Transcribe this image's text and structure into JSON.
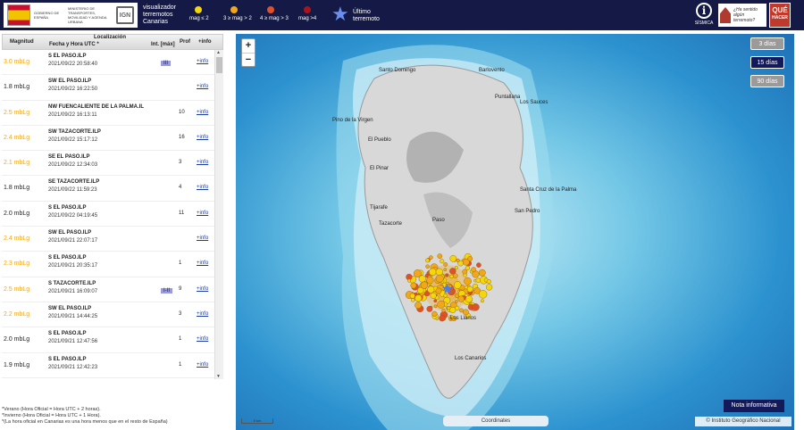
{
  "header": {
    "gov_text": "GOBIERNO DE ESPAÑA",
    "ministry_text": "MINISTERIO DE TRANSPORTES, MOVILIDAD Y AGENDA URBANA",
    "app_title_lines": [
      "visualizador",
      "terremotos",
      "Canarias"
    ],
    "legend": [
      {
        "label": "mag ≤ 2",
        "color": "#f5d60a"
      },
      {
        "label": "3 ≥ mag > 2",
        "color": "#f0a81a"
      },
      {
        "label": "4 ≥ mag > 3",
        "color": "#e0502a"
      },
      {
        "label": "mag >4",
        "color": "#a8141c"
      }
    ],
    "last_quake_label_lines": [
      "Último",
      "terremoto"
    ],
    "sismica_label": "SÍSMICA",
    "felt_lines": [
      "¿Ha sentido",
      "algún",
      "terremoto?"
    ],
    "que_hacer": [
      "QUÉ",
      "HACER"
    ]
  },
  "table": {
    "col_magnitud": "Magnitud",
    "col_localizacion": "Localización",
    "col_fecha": "Fecha y Hora UTC *",
    "col_int": "Int. [máx]",
    "col_prof": "Prof",
    "col_info": "+info",
    "rows": [
      {
        "mag": "3.0 mbLg",
        "mag_color": "#f0a81a",
        "loc": "S EL PASO.ILP",
        "dt": "2021/09/22 20:58:40",
        "int": "III",
        "prof": "",
        "info": "+info"
      },
      {
        "mag": "1.8 mbLg",
        "mag_color": "#222222",
        "loc": "SW EL PASO.ILP",
        "dt": "2021/09/22 16:22:50",
        "int": "",
        "prof": "",
        "info": "+info"
      },
      {
        "mag": "2.5 mbLg",
        "mag_color": "#f0a81a",
        "loc": "NW FUENCALIENTE DE LA PALMA.IL",
        "dt": "2021/09/22 16:13:11",
        "int": "",
        "prof": "10",
        "info": "+info"
      },
      {
        "mag": "2.4 mbLg",
        "mag_color": "#f0a81a",
        "loc": "SW TAZACORTE.ILP",
        "dt": "2021/09/22 15:17:12",
        "int": "",
        "prof": "16",
        "info": "+info"
      },
      {
        "mag": "2.1 mbLg",
        "mag_color": "#f0a81a",
        "loc": "SE EL PASO.ILP",
        "dt": "2021/09/22 12:34:03",
        "int": "",
        "prof": "3",
        "info": "+info"
      },
      {
        "mag": "1.8 mbLg",
        "mag_color": "#222222",
        "loc": "SE TAZACORTE.ILP",
        "dt": "2021/09/22 11:59:23",
        "int": "",
        "prof": "4",
        "info": "+info"
      },
      {
        "mag": "2.0 mbLg",
        "mag_color": "#222222",
        "loc": "S EL PASO.ILP",
        "dt": "2021/09/22 04:19:45",
        "int": "",
        "prof": "11",
        "info": "+info"
      },
      {
        "mag": "2.4 mbLg",
        "mag_color": "#f0a81a",
        "loc": "SW EL PASO.ILP",
        "dt": "2021/09/21 22:07:17",
        "int": "",
        "prof": "",
        "info": "+info"
      },
      {
        "mag": "2.3 mbLg",
        "mag_color": "#f0a81a",
        "loc": "S EL PASO.ILP",
        "dt": "2021/09/21 20:35:17",
        "int": "",
        "prof": "1",
        "info": "+info"
      },
      {
        "mag": "2.5 mbLg",
        "mag_color": "#f0a81a",
        "loc": "S TAZACORTE.ILP",
        "dt": "2021/09/21 16:09:07",
        "int": "I-II",
        "prof": "9",
        "info": "+info"
      },
      {
        "mag": "2.2 mbLg",
        "mag_color": "#f0a81a",
        "loc": "SW EL PASO.ILP",
        "dt": "2021/09/21 14:44:25",
        "int": "",
        "prof": "3",
        "info": "+info"
      },
      {
        "mag": "2.0 mbLg",
        "mag_color": "#222222",
        "loc": "S EL PASO.ILP",
        "dt": "2021/09/21 12:47:56",
        "int": "",
        "prof": "1",
        "info": "+info"
      },
      {
        "mag": "1.9 mbLg",
        "mag_color": "#222222",
        "loc": "S EL PASO.ILP",
        "dt": "2021/09/21 12:42:23",
        "int": "",
        "prof": "1",
        "info": "+info"
      },
      {
        "mag": "2.1 mbLg",
        "mag_color": "#f0a81a",
        "loc": "S EL PASO.ILP",
        "dt": "2021/09/21 12:35:52",
        "int": "",
        "prof": "1",
        "info": "+info"
      }
    ]
  },
  "notes": [
    "*Verano (Hora Oficial = Hora UTC + 2 horas).",
    "*Invierno (Hora Oficial = Hora UTC + 1 Hora).",
    "*(La hora oficial en Canarias es una hora menos que en el resto de España)"
  ],
  "map": {
    "zoom_in": "+",
    "zoom_out": "−",
    "day_buttons": [
      {
        "label": "3 días",
        "active": false
      },
      {
        "label": "15 días",
        "active": true
      },
      {
        "label": "90 días",
        "active": false
      }
    ],
    "nota": "Nota informativa",
    "coordinates": "Coordinates",
    "attribution": "© Instituto Geográfico Nacional",
    "scale": "5 km",
    "place_names": [
      "Santo Domingo",
      "Barlovento",
      "Puntallana",
      "Los Sauces",
      "Pino de la Virgen",
      "El Pinar",
      "Santa Cruz de la Palma",
      "San Pedro",
      "Tijarafe",
      "Tazacorte",
      "Paso",
      "Los Llanos",
      "Los Canarios",
      "El Pueblo"
    ]
  }
}
